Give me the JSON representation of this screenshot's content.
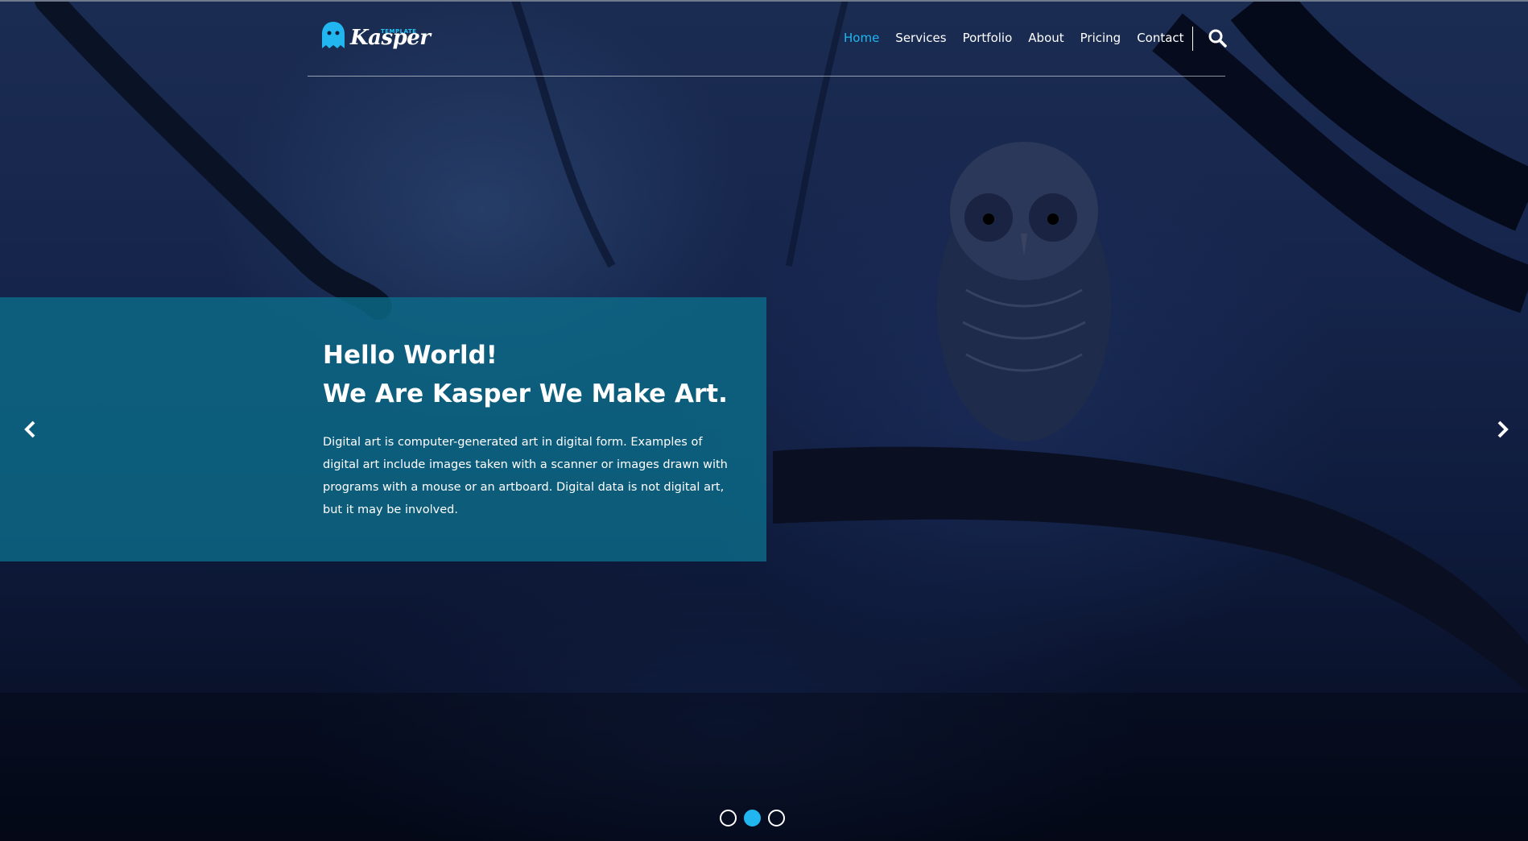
{
  "brand": {
    "name": "Kasper",
    "tagline": "TEMPLATE",
    "accent": "#21b6f0"
  },
  "nav": {
    "items": [
      {
        "label": "Home",
        "active": true
      },
      {
        "label": "Services",
        "active": false
      },
      {
        "label": "Portfolio",
        "active": false
      },
      {
        "label": "About",
        "active": false
      },
      {
        "label": "Pricing",
        "active": false
      },
      {
        "label": "Contact",
        "active": false
      }
    ],
    "search_icon": "search-icon"
  },
  "slide": {
    "title_line1": "Hello World!",
    "title_line2": "We Are Kasper We Make Art.",
    "body": "Digital art is computer-generated art in digital form. Examples of digital art include images taken with a scanner or images drawn with programs with a mouse or an artboard. Digital data is not digital art, but it may be involved.",
    "caption_color": "#0b6e8c"
  },
  "carousel": {
    "prev_icon": "chevron-left-icon",
    "next_icon": "chevron-right-icon",
    "slide_count": 3,
    "active_index": 1
  }
}
